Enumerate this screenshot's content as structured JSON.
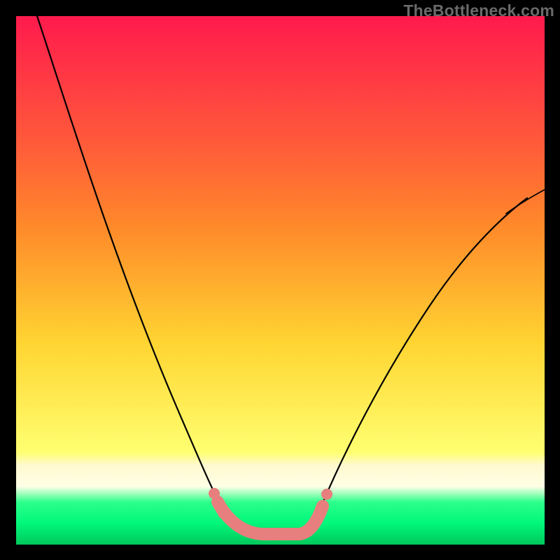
{
  "watermark": "TheBottleneck.com",
  "colors": {
    "background": "#000000",
    "gradient_top": "#ff1a4d",
    "gradient_mid_orange": "#ff8a2a",
    "gradient_yellow": "#ffd532",
    "gradient_pale": "#ffffe6",
    "gradient_green": "#00f77a",
    "curve": "#000000",
    "marker": "#e77f7e",
    "watermark_text": "#6a6a6a"
  },
  "chart_data": {
    "type": "line",
    "title": "",
    "xlabel": "",
    "ylabel": "",
    "xlim": [
      0,
      100
    ],
    "ylim": [
      0,
      100
    ],
    "grid": false,
    "legend": null,
    "annotations": [
      "TheBottleneck.com"
    ],
    "series": [
      {
        "name": "bottleneck-curve",
        "x": [
          5,
          10,
          15,
          20,
          25,
          30,
          33,
          35,
          37,
          39,
          41,
          43,
          45,
          50,
          55,
          60,
          65,
          70,
          75,
          80,
          85,
          90,
          95,
          100
        ],
        "values": [
          100,
          87,
          74,
          61,
          48,
          35,
          27,
          22,
          16,
          10,
          6,
          3,
          2,
          2,
          3,
          6,
          12,
          20,
          29,
          38,
          46,
          53,
          59,
          64
        ]
      }
    ],
    "markers": {
      "name": "bottom-highlight",
      "x": [
        37,
        39,
        41,
        43,
        45,
        47,
        49,
        51,
        53,
        55,
        57
      ],
      "values": [
        11,
        7,
        4,
        2,
        2,
        2,
        2,
        2,
        3,
        4,
        8
      ]
    }
  }
}
